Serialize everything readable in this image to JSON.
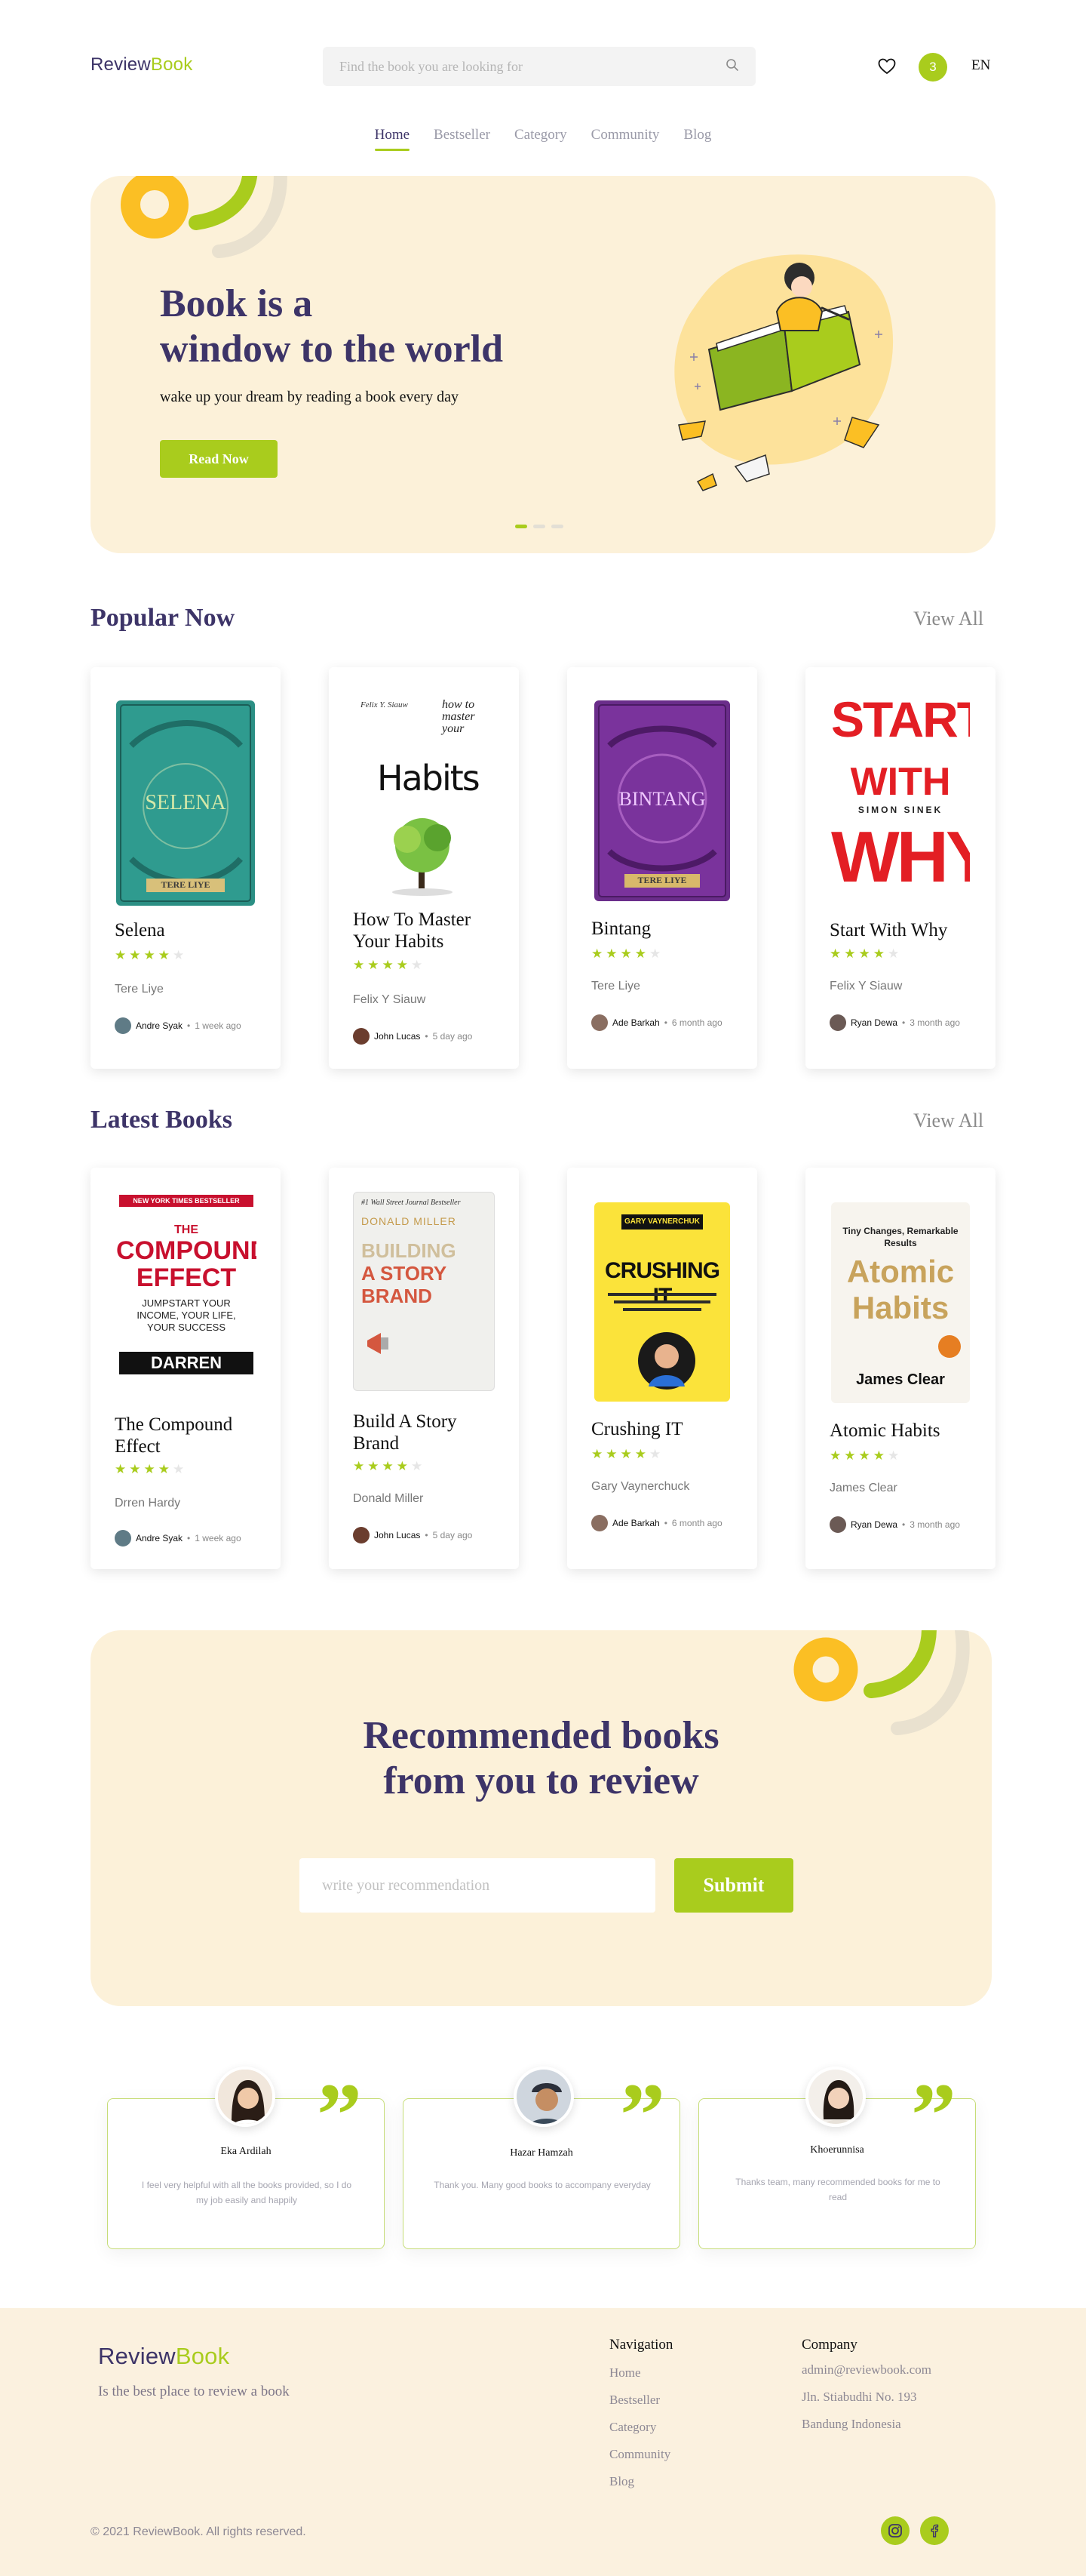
{
  "brand": {
    "part1": "Review",
    "part2": "Book"
  },
  "search": {
    "placeholder": "Find the book you are looking for"
  },
  "header": {
    "cart_count": "3",
    "language": "EN"
  },
  "nav": [
    "Home",
    "Bestseller",
    "Category",
    "Community",
    "Blog"
  ],
  "hero": {
    "title_line1": "Book is a",
    "title_line2": "window to the world",
    "subtitle": "wake up your dream by reading a book every day",
    "cta": "Read Now",
    "slides_total": 3,
    "slide_active": 1
  },
  "popular": {
    "title": "Popular Now",
    "view_all": "View All",
    "books": [
      {
        "title": "Selena",
        "author": "Tere Liye",
        "rating": 4,
        "reviewer": "Andre Syak",
        "time": "1 week ago"
      },
      {
        "title": "How To Master Your Habits",
        "author": "Felix Y Siauw",
        "rating": 4,
        "reviewer": "John Lucas",
        "time": "5 day ago"
      },
      {
        "title": "Bintang",
        "author": "Tere Liye",
        "rating": 4,
        "reviewer": "Ade Barkah",
        "time": "6 month ago"
      },
      {
        "title": "Start With Why",
        "author": "Felix Y Siauw",
        "rating": 4,
        "reviewer": "Ryan Dewa",
        "time": "3 month ago"
      }
    ]
  },
  "latest": {
    "title": "Latest Books",
    "view_all": "View All",
    "books": [
      {
        "title": "The Compound Effect",
        "author": "Drren Hardy",
        "rating": 4,
        "reviewer": "Andre Syak",
        "time": "1 week ago"
      },
      {
        "title": "Build A Story Brand",
        "author": "Donald Miller",
        "rating": 4,
        "reviewer": "John Lucas",
        "time": "5 day ago"
      },
      {
        "title": "Crushing IT",
        "author": "Gary Vaynerchuck",
        "rating": 4,
        "reviewer": "Ade Barkah",
        "time": "6 month ago"
      },
      {
        "title": "Atomic Habits",
        "author": "James Clear",
        "rating": 4,
        "reviewer": "Ryan Dewa",
        "time": "3 month ago"
      }
    ]
  },
  "covers": {
    "selena": {
      "title": "SELENA",
      "author": "TERE LIYE"
    },
    "habits": {
      "author": "Felix Y. Siauw",
      "top": "how to master your",
      "word": "Habits"
    },
    "bintang": {
      "title": "BINTANG",
      "author": "TERE LIYE"
    },
    "why": {
      "line1": "START",
      "line2": "WITH",
      "line3": "WHY",
      "author": "SIMON SINEK"
    },
    "compound": {
      "top": "NEW YORK TIMES BESTSELLER",
      "line1": "THE",
      "line2": "COMPOUND",
      "line3": "EFFECT",
      "sub": "JUMPSTART YOUR INCOME, YOUR LIFE, YOUR SUCCESS",
      "author": "DARREN HARDY"
    },
    "brand": {
      "top": "#1 Wall Street Journal Bestseller",
      "author": "DONALD MILLER",
      "line1": "BUILDING",
      "line2": "A STORY",
      "line3": "BRAND"
    },
    "crushing": {
      "author": "GARY VAYNERCHUK",
      "title": "CRUSHING IT"
    },
    "atomic": {
      "top": "Tiny Changes, Remarkable Results",
      "line1": "Atomic",
      "line2": "Habits",
      "author": "James Clear"
    }
  },
  "recommend": {
    "title_line1": "Recommended books",
    "title_line2": "from you to review",
    "placeholder": "write your recommendation",
    "submit": "Submit"
  },
  "testimonials": [
    {
      "name": "Eka Ardilah",
      "text": "I feel very helpful with all the books provided, so I do my job easily and happily"
    },
    {
      "name": "Hazar Hamzah",
      "text": "Thank you. Many good books to accompany everyday"
    },
    {
      "name": "Khoerunnisa",
      "text": "Thanks team, many recommended books for me to read"
    }
  ],
  "footer": {
    "tagline": "Is the best place to review a book",
    "nav_title": "Navigation",
    "nav_links": [
      "Home",
      "Bestseller",
      "Category",
      "Community",
      "Blog"
    ],
    "company_title": "Company",
    "email": "admin@reviewbook.com",
    "address1": "Jln. Stiabudhi No. 193",
    "address2": "Bandung Indonesia",
    "copyright": "© 2021 ReviewBook. All rights reserved.",
    "social": [
      "instagram-icon",
      "facebook-icon"
    ]
  },
  "colors": {
    "accent": "#a9cc1d",
    "brand": "#3d3468",
    "cream": "#fcf1d9",
    "yellow": "#fbbf24"
  }
}
